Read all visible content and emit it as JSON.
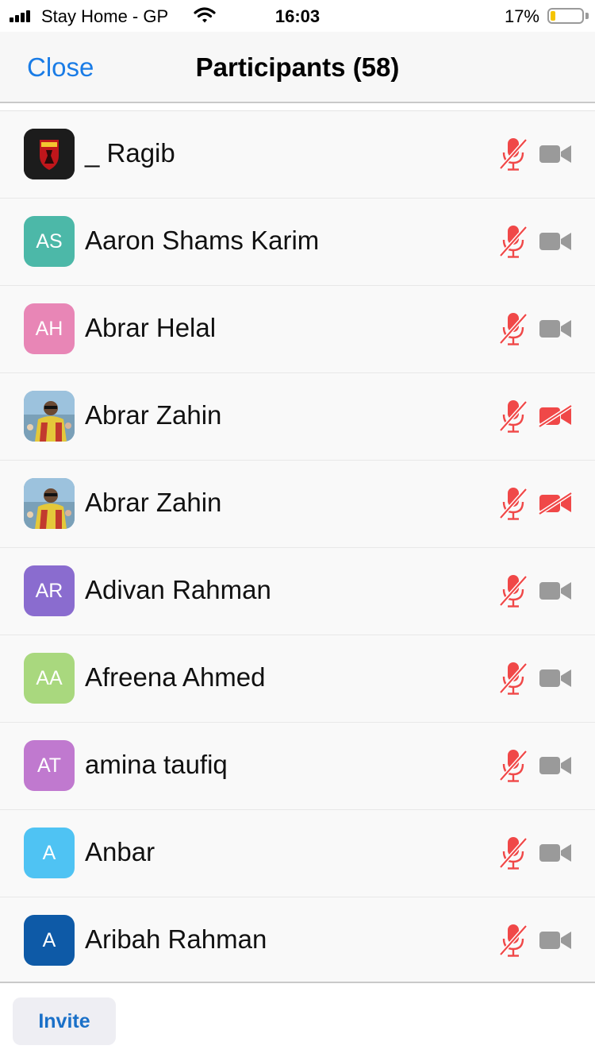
{
  "status_bar": {
    "carrier": "Stay Home - GP",
    "time": "16:03",
    "battery_percent": "17%",
    "battery_level": 0.17
  },
  "nav": {
    "close_label": "Close",
    "title": "Participants (58)"
  },
  "participants": [
    {
      "name": "_ Ragib",
      "initials": "",
      "avatar_type": "logo",
      "avatar_color": "#1c1c1c",
      "mic_muted": true,
      "video_off": false
    },
    {
      "name": "Aaron Shams Karim",
      "initials": "AS",
      "avatar_type": "initials",
      "avatar_color": "#4cb8a8",
      "mic_muted": true,
      "video_off": false
    },
    {
      "name": "Abrar Helal",
      "initials": "AH",
      "avatar_type": "initials",
      "avatar_color": "#e886b6",
      "mic_muted": true,
      "video_off": false
    },
    {
      "name": "Abrar Zahin",
      "initials": "",
      "avatar_type": "photo",
      "avatar_color": "#7aa8c8",
      "mic_muted": true,
      "video_off": true
    },
    {
      "name": "Abrar Zahin",
      "initials": "",
      "avatar_type": "photo",
      "avatar_color": "#7aa8c8",
      "mic_muted": true,
      "video_off": true
    },
    {
      "name": "Adivan Rahman",
      "initials": "AR",
      "avatar_type": "initials",
      "avatar_color": "#8a6ccf",
      "mic_muted": true,
      "video_off": false
    },
    {
      "name": "Afreena Ahmed",
      "initials": "AA",
      "avatar_type": "initials",
      "avatar_color": "#a9d87e",
      "mic_muted": true,
      "video_off": false
    },
    {
      "name": "amina taufiq",
      "initials": "AT",
      "avatar_type": "initials",
      "avatar_color": "#c079cf",
      "mic_muted": true,
      "video_off": false
    },
    {
      "name": "Anbar",
      "initials": "A",
      "avatar_type": "initials",
      "avatar_color": "#4fc3f3",
      "mic_muted": true,
      "video_off": false
    },
    {
      "name": "Aribah Rahman",
      "initials": "A",
      "avatar_type": "initials",
      "avatar_color": "#0e5aa7",
      "mic_muted": true,
      "video_off": false
    }
  ],
  "colors": {
    "accent": "#1a7ce6",
    "muted_red": "#f04848",
    "camera_gray": "#9a9a9a"
  },
  "icons": {
    "mic": "mic-muted-icon",
    "camera_on": "video-camera-icon",
    "camera_off": "video-off-icon"
  },
  "footer": {
    "invite_label": "Invite"
  }
}
